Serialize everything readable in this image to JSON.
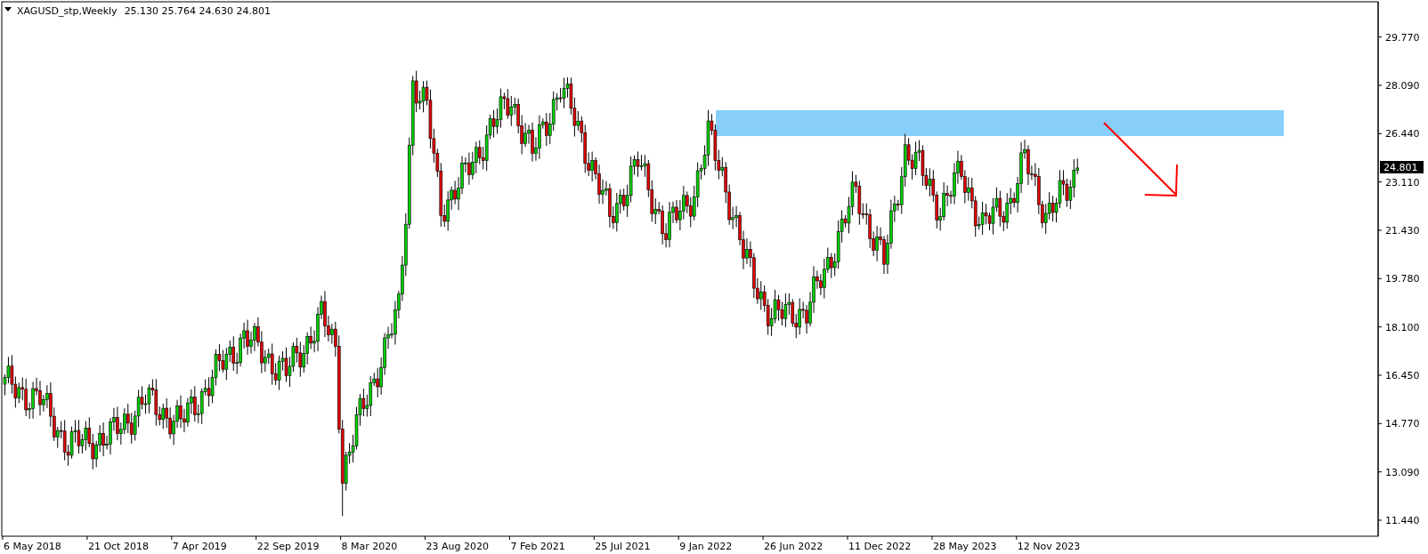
{
  "header": {
    "symbol": "XAGUSD_stp,Weekly",
    "ohlc": "25.130 25.764 24.630 24.801"
  },
  "price_axis": [
    "29.770",
    "28.090",
    "26.440",
    "23.110",
    "21.430",
    "19.780",
    "18.100",
    "16.450",
    "14.770",
    "13.090",
    "11.440"
  ],
  "current_price": "24.801",
  "time_axis": [
    "6 May 2018",
    "21 Oct 2018",
    "7 Apr 2019",
    "22 Sep 2019",
    "8 Mar 2020",
    "23 Aug 2020",
    "7 Feb 2021",
    "25 Jul 2021",
    "9 Jan 2022",
    "26 Jun 2022",
    "11 Dec 2022",
    "28 May 2023",
    "12 Nov 2023"
  ]
}
